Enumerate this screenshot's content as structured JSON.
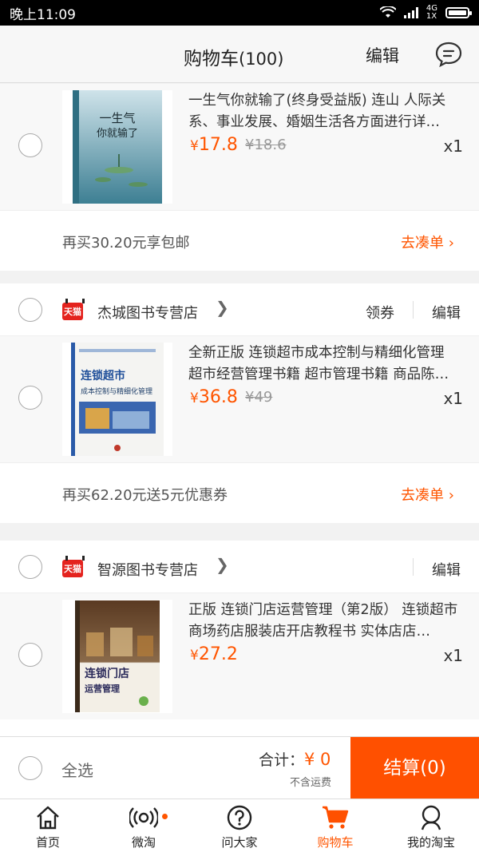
{
  "statusbar": {
    "time": "晚上11:09",
    "network": "4G",
    "network_sub": "1X"
  },
  "header": {
    "title": "购物车",
    "count": "(100)",
    "edit": "编辑"
  },
  "card1": {
    "item": {
      "title": "一生气你就输了(终身受益版) 连山 人际关系、事业发展、婚姻生活各方面进行详…",
      "currency": "¥",
      "price": "17.8",
      "original": "¥18.6",
      "qty": "x1"
    },
    "promo": {
      "text": "再买30.20元享包邮",
      "action": "去凑单"
    }
  },
  "card2": {
    "shop": {
      "name": "杰城图书专营店",
      "badge": "天猫",
      "coupon": "领券",
      "edit": "编辑"
    },
    "item": {
      "title": "全新正版 连锁超市成本控制与精细化管理 超市经营管理书籍 超市管理书籍 商品陈…",
      "currency": "¥",
      "price": "36.8",
      "original": "¥49",
      "qty": "x1",
      "cover_title": "连锁超市",
      "cover_sub": "成本控制与精细化管理"
    },
    "promo": {
      "text": "再买62.20元送5元优惠券",
      "action": "去凑单"
    }
  },
  "card3": {
    "shop": {
      "name": "智源图书专营店",
      "badge": "天猫",
      "edit": "编辑"
    },
    "item": {
      "title": "正版 连锁门店运营管理（第2版） 连锁超市商场药店服装店开店教程书 实体店店…",
      "currency": "¥",
      "price": "27.2",
      "qty": "x1",
      "cover_title": "连锁门店",
      "cover_sub": "运营管理"
    }
  },
  "cover1": {
    "title": "一生气你就输了"
  },
  "bottom": {
    "select_all": "全选",
    "total_label": "合计：",
    "total_amount": "¥ 0",
    "shipping": "不含运费",
    "checkout": "结算(0)"
  },
  "tabs": [
    {
      "label": "首页"
    },
    {
      "label": "微淘"
    },
    {
      "label": "问大家"
    },
    {
      "label": "购物车"
    },
    {
      "label": "我的淘宝"
    }
  ],
  "colors": {
    "accent": "#ff5000",
    "tmall": "#e4231e"
  }
}
